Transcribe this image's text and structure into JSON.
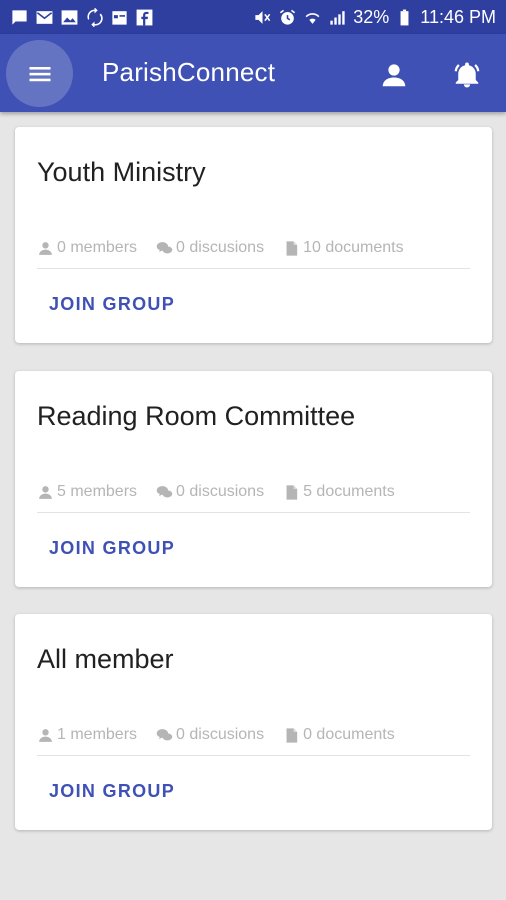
{
  "status_bar": {
    "battery": "32%",
    "time": "11:46 PM",
    "left_icons": [
      "chat-icon",
      "mail-icon",
      "image-icon",
      "sync-icon",
      "calendar-icon",
      "facebook-icon"
    ],
    "right_icons": [
      "mute-icon",
      "alarm-icon",
      "wifi-icon",
      "signal-icon",
      "battery-icon"
    ]
  },
  "app_bar": {
    "title": "ParishConnect",
    "menu_icon": "menu-icon",
    "profile_icon": "person-icon",
    "notification_icon": "bell-icon"
  },
  "groups": [
    {
      "name": "Youth Ministry",
      "members": "0 members",
      "discussions": "0 discusions",
      "documents": "10 documents",
      "action": "JOIN GROUP"
    },
    {
      "name": "Reading Room Committee",
      "members": "5 members",
      "discussions": "0 discusions",
      "documents": "5 documents",
      "action": "JOIN GROUP"
    },
    {
      "name": "All member",
      "members": "1 members",
      "discussions": "0 discusions",
      "documents": "0 documents",
      "action": "JOIN GROUP"
    }
  ],
  "colors": {
    "status_bar": "#2f3fa0",
    "app_bar": "#3f51b5",
    "accent": "#3f51b5",
    "background": "#e6e6e6",
    "meta_text": "#b5b5b5"
  }
}
